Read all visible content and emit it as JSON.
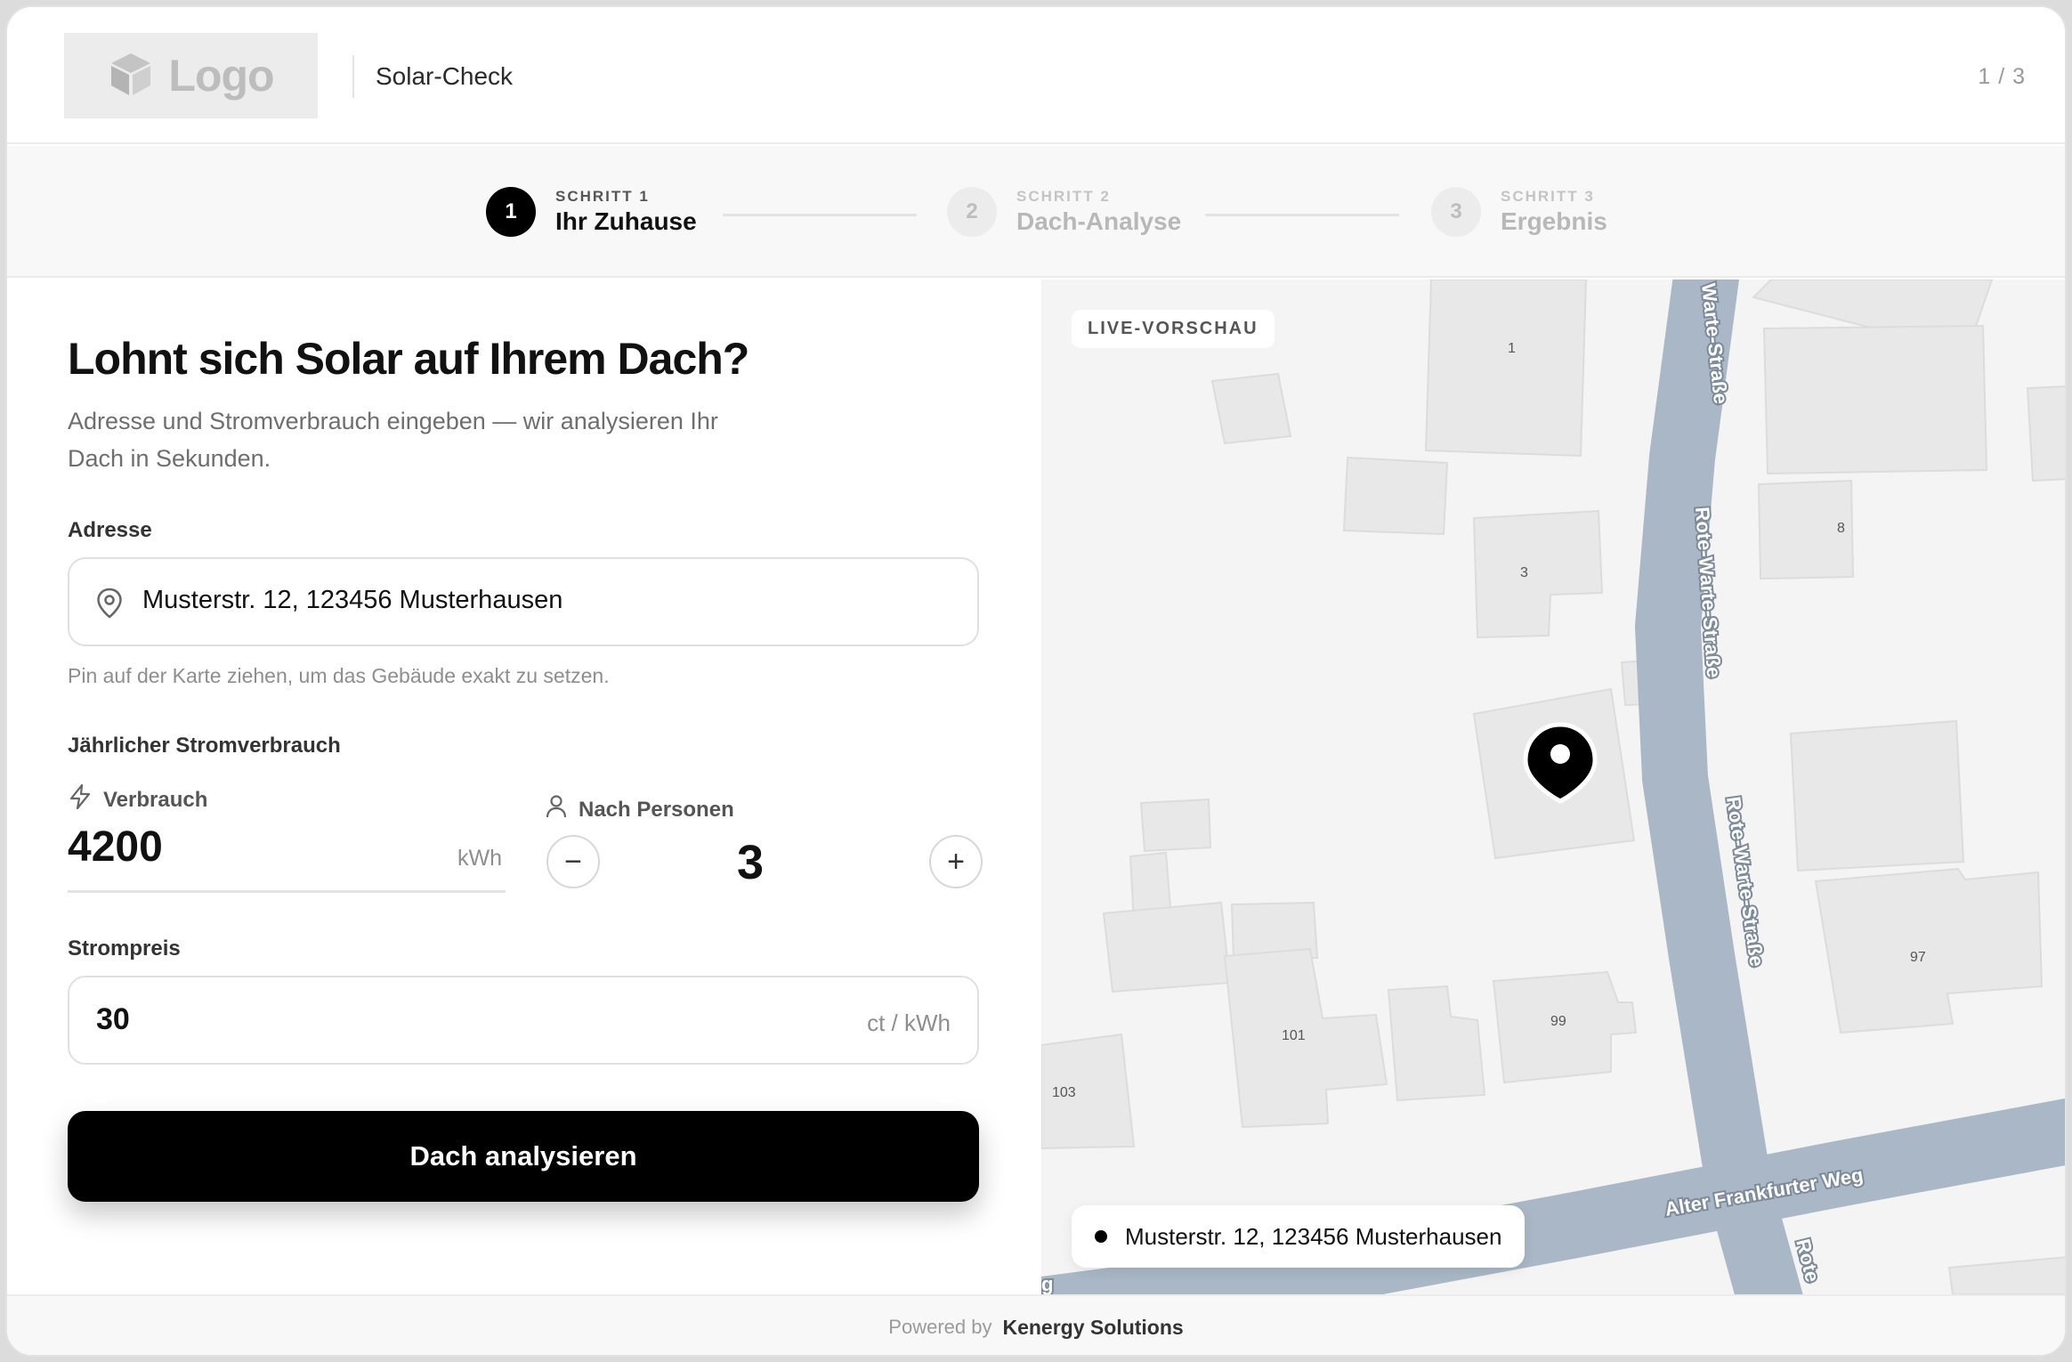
{
  "header": {
    "logo_label": "Logo",
    "app_title": "Solar-Check",
    "page_counter": "1 / 3"
  },
  "stepper": {
    "steps": [
      {
        "kicker": "SCHRITT 1",
        "name": "Ihr Zuhause",
        "number": "1",
        "state": "active"
      },
      {
        "kicker": "SCHRITT 2",
        "name": "Dach-Analyse",
        "number": "2",
        "state": "inactive"
      },
      {
        "kicker": "SCHRITT 3",
        "name": "Ergebnis",
        "number": "3",
        "state": "inactive"
      }
    ]
  },
  "form": {
    "title": "Lohnt sich Solar auf Ihrem Dach?",
    "subtitle": "Adresse und Stromverbrauch eingeben — wir analysieren Ihr Dach in Sekunden.",
    "address": {
      "label": "Adresse",
      "value": "Musterstr. 12, 123456 Musterhausen",
      "hint": "Pin auf der Karte ziehen, um das Gebäude exakt zu setzen."
    },
    "consumption": {
      "label": "Jährlicher Stromverbrauch",
      "mode_label": "Verbrauch",
      "value": "4200",
      "unit": "kWh",
      "persons_label": "Nach Personen",
      "persons_value": "3",
      "minus": "−",
      "plus": "+"
    },
    "price": {
      "label": "Strompreis",
      "value": "30",
      "unit": "ct / kWh"
    },
    "submit_label": "Dach analysieren"
  },
  "map": {
    "badge": "LIVE-VORSCHAU",
    "selected_address": "Musterstr. 12, 123456 Musterhausen",
    "street_labels": {
      "rote_warte": "Rote-Warte-Straße",
      "warte_top": "Warte-Straße",
      "alter_frankfurter": "Alter Frankfurter Weg",
      "rote_short": "Rote",
      "edge": "g"
    },
    "house_numbers": {
      "n1": "1",
      "n3": "3",
      "n8": "8",
      "n97": "97",
      "n99": "99",
      "n101": "101",
      "n103": "103"
    },
    "colors": {
      "road": "#a9b7c6",
      "building": "#e8e8e8",
      "pin": "#000000"
    }
  },
  "footer": {
    "powered_by": "Powered by",
    "brand": "Kenergy Solutions"
  }
}
